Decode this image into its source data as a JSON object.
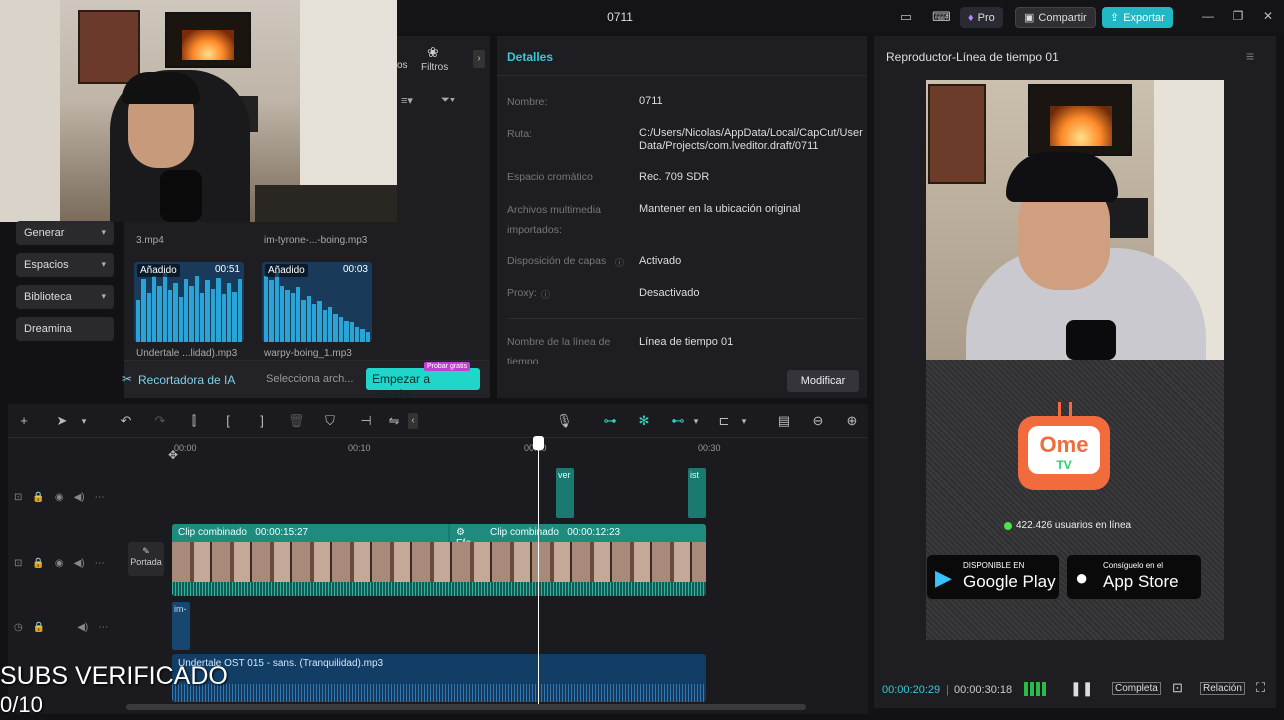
{
  "titlebar": {
    "title": "0711",
    "pro_label": "Pro",
    "share_label": "Compartir",
    "export_label": "Exportar"
  },
  "left_nav": [
    {
      "label": "Generar"
    },
    {
      "label": "Espacios"
    },
    {
      "label": "Biblioteca"
    },
    {
      "label": "Dreamina"
    }
  ],
  "media_tabs": {
    "truncated_tab": "os",
    "filters_label": "Filtros"
  },
  "media": {
    "top_items": [
      "3.mp4",
      "im-tyrone-...-boing.mp3"
    ],
    "items": [
      {
        "badge": "Añadido",
        "duration": "00:51",
        "name": "Undertale ...lidad).mp3"
      },
      {
        "badge": "Añadido",
        "duration": "00:03",
        "name": "warpy-boing_1.mp3"
      }
    ]
  },
  "ai_bar": {
    "title": "Recortadora de IA",
    "select_placeholder": "Selecciona arch...",
    "button": "Empezar a recortar",
    "tag": "Probar gratis"
  },
  "details": {
    "title": "Detalles",
    "rows": [
      {
        "label": "Nombre:",
        "value": "0711"
      },
      {
        "label": "Ruta:",
        "value": "C:/Users/Nicolas/AppData/Local/CapCut/User Data/Projects/com.lveditor.draft/0711"
      },
      {
        "label": "Espacio cromático",
        "value": "Rec. 709 SDR"
      },
      {
        "label": "Archivos multimedia importados:",
        "value": "Mantener en la ubicación original"
      },
      {
        "label": "Disposición de capas",
        "value": "Activado"
      },
      {
        "label": "Proxy:",
        "value": "Desactivado"
      },
      {
        "label": "Nombre de la línea de tiempo",
        "value": "Línea de tiempo 01"
      }
    ],
    "modify_label": "Modificar"
  },
  "player": {
    "title": "Reproductor-Línea de tiempo 01",
    "current_time": "00:00:20:29",
    "total_time": "00:00:30:18",
    "full_label": "Completa",
    "ratio_label": "Relación",
    "ome": {
      "word": "Ome",
      "tv": "TV",
      "online": "422.426 usuarios en línea",
      "gp_small": "DISPONIBLE EN",
      "gp_big": "Google Play",
      "as_small": "Consíguelo en el",
      "as_big": "App Store"
    }
  },
  "timeline": {
    "ruler": [
      "00:00",
      "00:10",
      "00:20",
      "00:30"
    ],
    "main_clip_1": {
      "label": "Clip combinado",
      "time": "00:00:15:27"
    },
    "main_clip_2": {
      "label": "Clip combinado",
      "time": "00:00:12:23"
    },
    "effect_label": "Efe",
    "small_clip_1": "ver",
    "small_clip_2": "ist",
    "audio_small": "im-",
    "audio_long": "Undertale OST 015 - sans. (Tranquilidad).mp3",
    "cover_label": "Portada"
  },
  "overlay": {
    "subs": "SUBS VERIFICADO",
    "count": "0/10"
  },
  "colors": {
    "accent": "#1fb8c4",
    "teal_clip": "#1b7a70",
    "audio_clip": "#123e66"
  }
}
